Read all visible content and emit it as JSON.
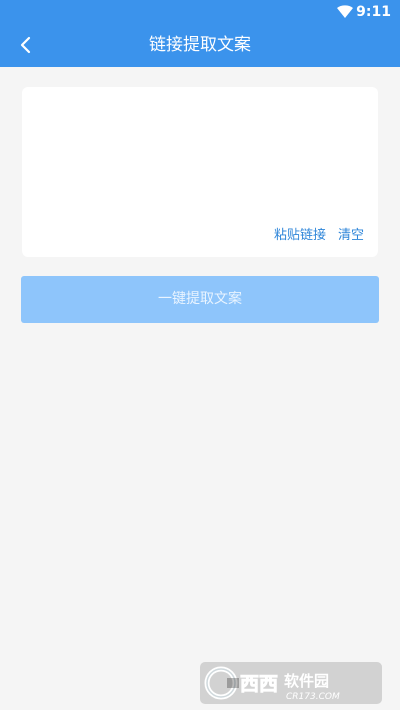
{
  "status_bar": {
    "time": "9:11"
  },
  "header": {
    "title": "链接提取文案",
    "back_icon": "back-arrow-icon"
  },
  "input": {
    "value": "",
    "placeholder": ""
  },
  "card_actions": {
    "paste_label": "粘贴链接",
    "clear_label": "清空"
  },
  "main": {
    "extract_button_label": "一键提取文案"
  },
  "watermark": {
    "text": "西西软件园",
    "subtext": "CR173.COM"
  },
  "colors": {
    "primary": "#3b93ec",
    "button_disabled": "#8ec5fb",
    "link": "#2f86d9",
    "background": "#f5f5f5"
  }
}
